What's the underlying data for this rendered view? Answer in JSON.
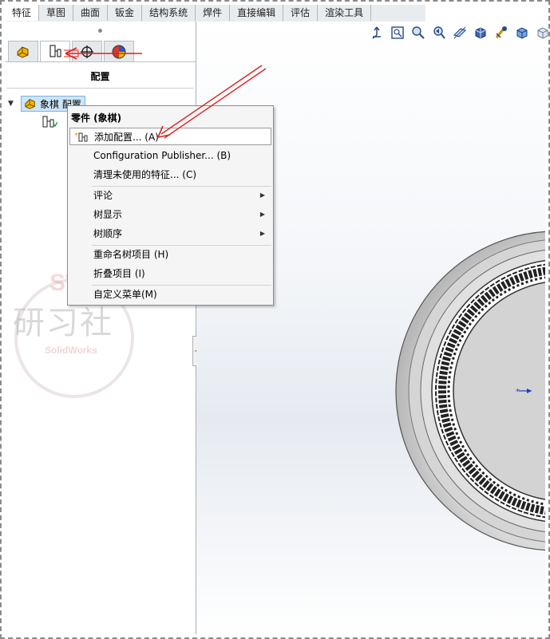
{
  "tabs": [
    "特征",
    "草图",
    "曲面",
    "钣金",
    "结构系统",
    "焊件",
    "直接编辑",
    "评估",
    "渲染工具"
  ],
  "panel": {
    "title": "配置",
    "tree_root_label": "象棋 配置"
  },
  "context_menu": {
    "header": "零件 (象棋)",
    "items": {
      "add_config": "添加配置... (A)",
      "config_publisher": "Configuration Publisher... (B)",
      "purge_unused": "清理未使用的特征... (C)",
      "comment": "评论",
      "tree_display": "树显示",
      "tree_order": "树顺序",
      "rename_tree_item": "重命名树项目 (H)",
      "collapse_items": "折叠项目 (I)",
      "customize_menu": "自定义菜单(M)"
    }
  },
  "watermark": {
    "sw": "SW",
    "cn": "研习社",
    "en": "SolidWorks"
  },
  "colors": {
    "annotation_arrow": "#e02020",
    "selection_bg": "#cde5f8",
    "origin_marker": "#1a3fd0"
  },
  "icons": [
    "feature-manager-icon",
    "configuration-manager-icon",
    "dimxpert-icon",
    "display-manager-icon",
    "view-orientation-icon",
    "zoom-to-fit-icon",
    "zoom-area-icon",
    "previous-view-icon",
    "section-view-icon",
    "display-style-icon",
    "view-settings-icon",
    "hide-show-icon",
    "edit-appearance-icon"
  ]
}
